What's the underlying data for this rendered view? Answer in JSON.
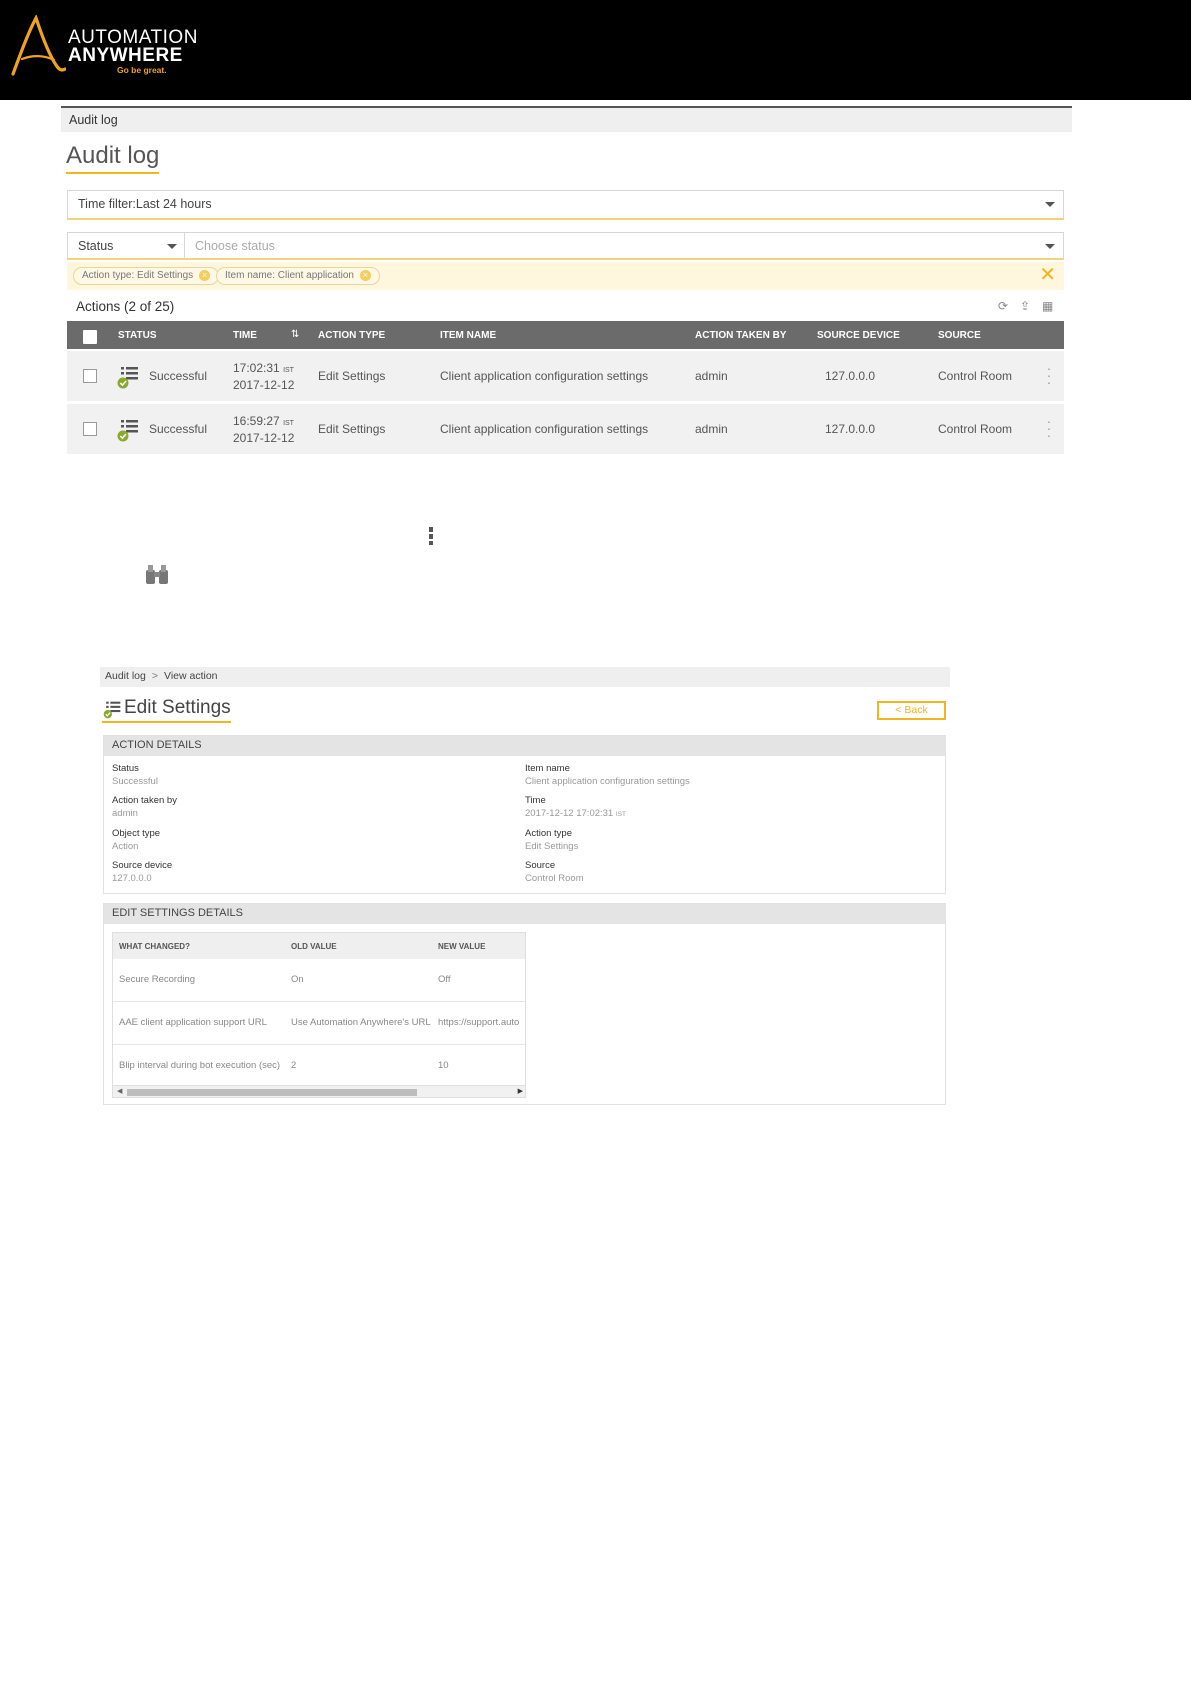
{
  "brand": {
    "line1": "AUTOMATION",
    "line2": "ANYWHERE",
    "tagline": "Go be great.",
    "accent": "#f1a31d"
  },
  "list_view": {
    "breadcrumb": "Audit log",
    "title": "Audit log",
    "time_filter": "Time filter:Last 24 hours",
    "status_select": "Status",
    "status_placeholder": "Choose status",
    "chips": [
      "Action type: Edit Settings",
      "Item name: Client application"
    ],
    "actions_title": "Actions (2 of 25)",
    "toolbar_icons": [
      "refresh-icon",
      "export-icon",
      "columns-icon"
    ],
    "columns": [
      "STATUS",
      "TIME",
      "ACTION TYPE",
      "ITEM NAME",
      "ACTION TAKEN BY",
      "SOURCE DEVICE",
      "SOURCE"
    ],
    "rows": [
      {
        "status": "Successful",
        "time": "17:02:31",
        "tz": "IST",
        "date": "2017-12-12",
        "action_type": "Edit Settings",
        "item_name": "Client application configuration settings",
        "taken_by": "admin",
        "device": "127.0.0.0",
        "source": "Control Room"
      },
      {
        "status": "Successful",
        "time": "16:59:27",
        "tz": "IST",
        "date": "2017-12-12",
        "action_type": "Edit Settings",
        "item_name": "Client application configuration settings",
        "taken_by": "admin",
        "device": "127.0.0.0",
        "source": "Control Room"
      }
    ]
  },
  "detail_view": {
    "breadcrumb_root": "Audit log",
    "breadcrumb_sep": ">",
    "breadcrumb_current": "View action",
    "title": "Edit Settings",
    "back_label": "< Back",
    "action_details_header": "ACTION DETAILS",
    "fields": {
      "status_label": "Status",
      "status_value": "Successful",
      "taken_by_label": "Action taken by",
      "taken_by_value": "admin",
      "object_type_label": "Object type",
      "object_type_value": "Action",
      "device_label": "Source device",
      "device_value": "127.0.0.0",
      "item_name_label": "Item name",
      "item_name_value": "Client application configuration settings",
      "time_label": "Time",
      "time_value": "2017-12-12 17:02:31",
      "time_tz": "IST",
      "action_type_label": "Action type",
      "action_type_value": "Edit Settings",
      "source_label": "Source",
      "source_value": "Control Room"
    },
    "edit_settings_header": "EDIT SETTINGS DETAILS",
    "changes_columns": [
      "WHAT CHANGED?",
      "OLD VALUE",
      "NEW VALUE"
    ],
    "changes": [
      {
        "what": "Secure Recording",
        "old": "On",
        "new": "Off"
      },
      {
        "what": "AAE client application support URL",
        "old": "Use Automation Anywhere's URL",
        "new": "https://support.auto"
      },
      {
        "what": "Blip interval during bot execution (sec)",
        "old": "2",
        "new": "10"
      }
    ]
  }
}
